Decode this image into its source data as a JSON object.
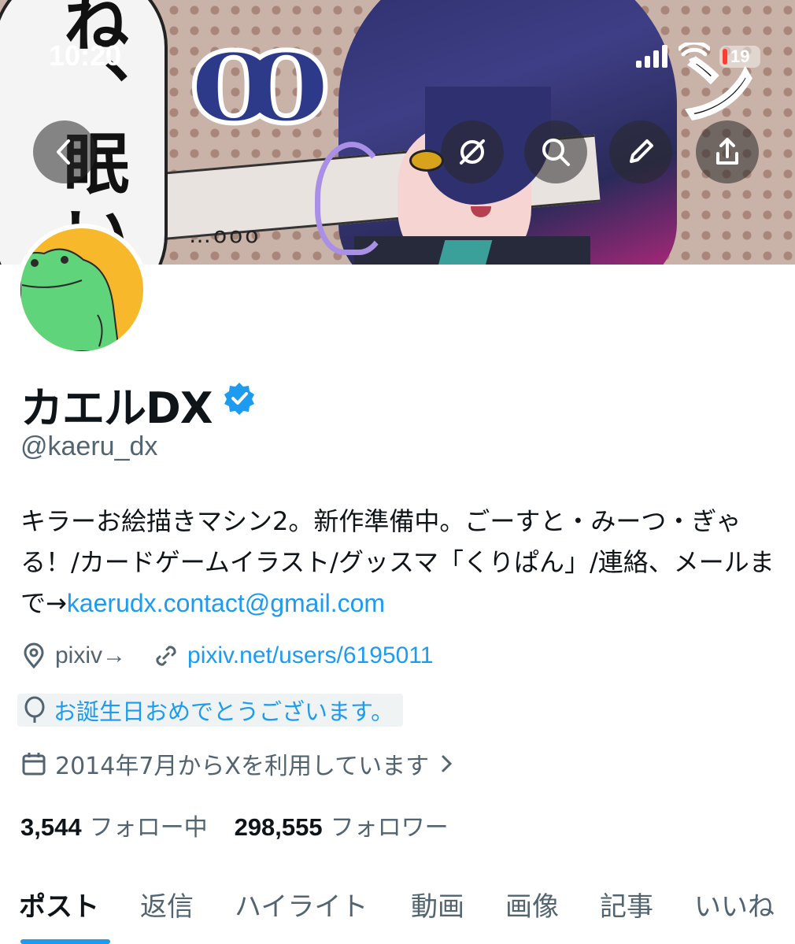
{
  "status_bar": {
    "time": "10:20",
    "battery": "19",
    "battery_color": "#ff3b30"
  },
  "banner": {
    "bubble_text": "ね、眠い",
    "dots": "…ooo",
    "right_text": "ンと、ン"
  },
  "header_buttons": {
    "back_icon": "chevron-left-icon",
    "grok_icon": "grok-icon",
    "search_icon": "search-icon",
    "edit_icon": "pencil-icon",
    "share_icon": "share-icon"
  },
  "profile": {
    "display_name": "カエルDX",
    "handle": "@kaeru_dx",
    "bio_text": "キラーお絵描きマシン2。新作準備中。ごーすと・みーつ・ぎゃる！/カードゲームイラスト/グッスマ「くりぱん」/連絡、メールまで→",
    "bio_link": "kaerudx.contact@gmail.com",
    "location": "pixiv→",
    "website": "pixiv.net/users/6195011",
    "birthday": "お誕生日おめでとうございます。",
    "joined": "2014年7月からXを利用しています",
    "following_count": "3,544",
    "following_label": "フォロー中",
    "followers_count": "298,555",
    "followers_label": "フォロワー"
  },
  "tabs": [
    "ポスト",
    "返信",
    "ハイライト",
    "動画",
    "画像",
    "記事",
    "いいね"
  ],
  "active_tab": "ポスト",
  "colors": {
    "accent": "#1d9bf0",
    "text_primary": "#0f1419",
    "text_secondary": "#536471",
    "avatar_bg": "#f7b92b",
    "frog": "#5fd47a"
  }
}
